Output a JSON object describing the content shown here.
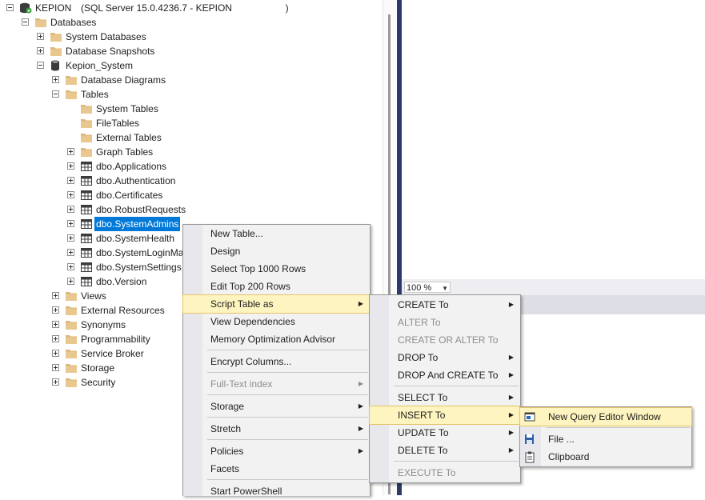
{
  "tree": {
    "server": {
      "name": "KEPION",
      "detail": "(SQL Server 15.0.4236.7 - KEPION                    )"
    },
    "databases": "Databases",
    "system_databases": "System Databases",
    "database_snapshots": "Database Snapshots",
    "kepion_system": "Kepion_System",
    "database_diagrams": "Database Diagrams",
    "tables": "Tables",
    "system_tables": "System Tables",
    "file_tables": "FileTables",
    "external_tables": "External Tables",
    "graph_tables": "Graph Tables",
    "table_items": [
      "dbo.Applications",
      "dbo.Authentication",
      "dbo.Certificates",
      "dbo.RobustRequests",
      "dbo.SystemAdmins",
      "dbo.SystemHealth",
      "dbo.SystemLoginMa",
      "dbo.SystemSettings",
      "dbo.Version"
    ],
    "views": "Views",
    "external_resources": "External Resources",
    "synonyms": "Synonyms",
    "programmability": "Programmability",
    "service_broker": "Service Broker",
    "storage": "Storage",
    "security": "Security"
  },
  "editor": {
    "zoom": "100 %"
  },
  "context_menu": {
    "new_table": "New Table...",
    "design": "Design",
    "select_top": "Select Top 1000 Rows",
    "edit_top": "Edit Top 200 Rows",
    "script_table_as": "Script Table as",
    "view_dependencies": "View Dependencies",
    "memory_optimization": "Memory Optimization Advisor",
    "encrypt_columns": "Encrypt Columns...",
    "full_text_index": "Full-Text index",
    "storage": "Storage",
    "stretch": "Stretch",
    "policies": "Policies",
    "facets": "Facets",
    "start_powershell": "Start PowerShell"
  },
  "script_submenu": {
    "create_to": "CREATE To",
    "alter_to": "ALTER To",
    "create_or_alter_to": "CREATE OR ALTER To",
    "drop_to": "DROP To",
    "drop_and_create_to": "DROP And CREATE To",
    "select_to": "SELECT To",
    "insert_to": "INSERT To",
    "update_to": "UPDATE To",
    "delete_to": "DELETE To",
    "execute_to": "EXECUTE To"
  },
  "insert_submenu": {
    "new_query_window": "New Query Editor Window",
    "file": "File ...",
    "clipboard": "Clipboard"
  },
  "colors": {
    "selection": "#0078d7",
    "folder": "#dcb67a",
    "splitter": "#2b3a6b",
    "menu_highlight": "#fdf4bf"
  }
}
